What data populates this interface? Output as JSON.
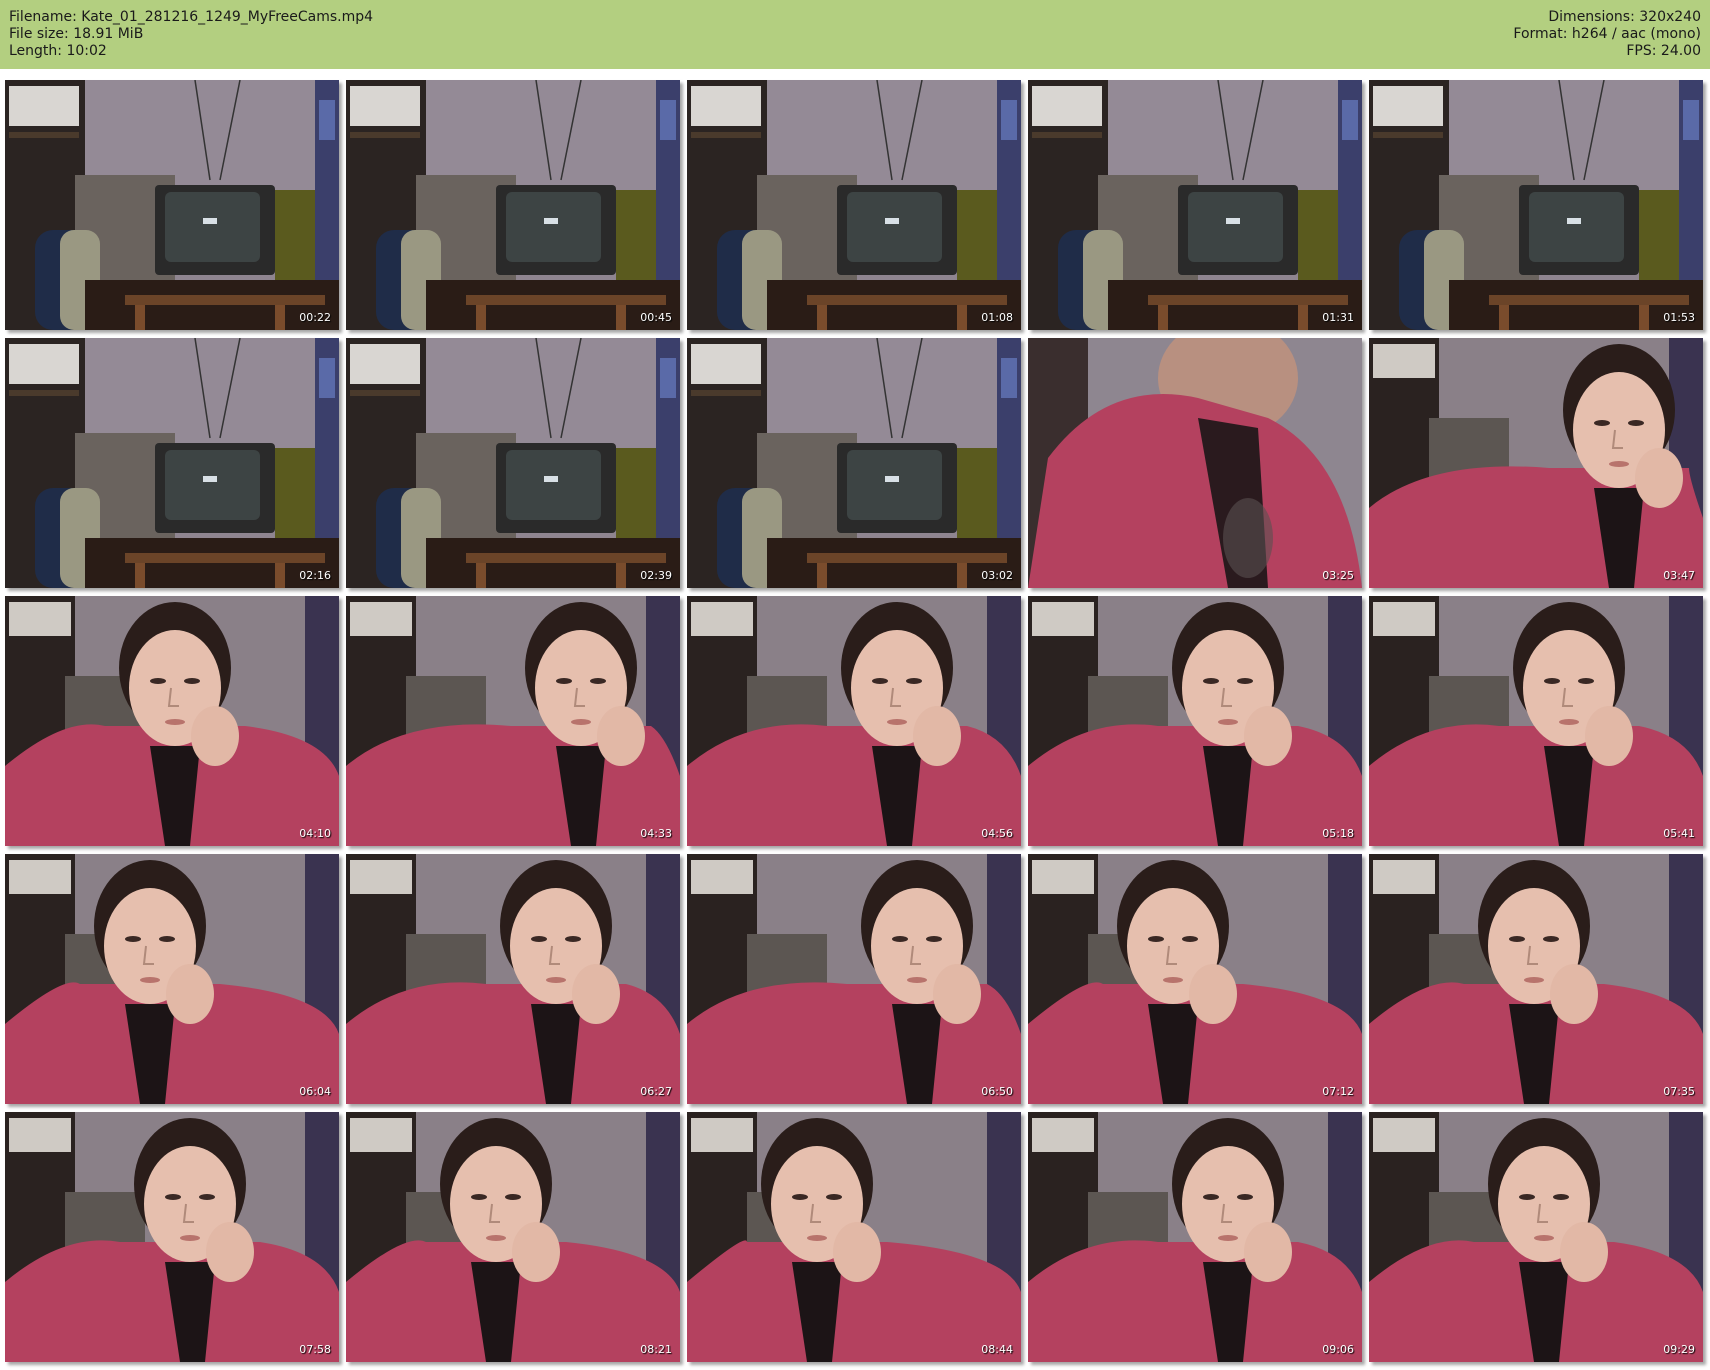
{
  "header": {
    "filename": "Filename: Kate_01_281216_1249_MyFreeCams.mp4",
    "filesize": "File size: 18.91 MiB",
    "length": "Length: 10:02",
    "dimensions": "Dimensions: 320x240",
    "format": "Format: h264 / aac (mono)",
    "fps": "FPS: 24.00"
  },
  "colors": {
    "header_bg": "#b3cf80",
    "jacket": "#b4415f",
    "wall": "#8f8590"
  },
  "frames": [
    {
      "time": "00:22",
      "scene": "room"
    },
    {
      "time": "00:45",
      "scene": "room"
    },
    {
      "time": "01:08",
      "scene": "room"
    },
    {
      "time": "01:31",
      "scene": "room"
    },
    {
      "time": "01:53",
      "scene": "room"
    },
    {
      "time": "02:16",
      "scene": "room"
    },
    {
      "time": "02:39",
      "scene": "room"
    },
    {
      "time": "03:02",
      "scene": "room"
    },
    {
      "time": "03:25",
      "scene": "blur"
    },
    {
      "time": "03:47",
      "scene": "person"
    },
    {
      "time": "04:10",
      "scene": "person"
    },
    {
      "time": "04:33",
      "scene": "person"
    },
    {
      "time": "04:56",
      "scene": "person"
    },
    {
      "time": "05:18",
      "scene": "person"
    },
    {
      "time": "05:41",
      "scene": "person"
    },
    {
      "time": "06:04",
      "scene": "person"
    },
    {
      "time": "06:27",
      "scene": "person"
    },
    {
      "time": "06:50",
      "scene": "person"
    },
    {
      "time": "07:12",
      "scene": "person"
    },
    {
      "time": "07:35",
      "scene": "person"
    },
    {
      "time": "07:58",
      "scene": "person"
    },
    {
      "time": "08:21",
      "scene": "person"
    },
    {
      "time": "08:44",
      "scene": "person"
    },
    {
      "time": "09:06",
      "scene": "person"
    },
    {
      "time": "09:29",
      "scene": "person"
    }
  ]
}
